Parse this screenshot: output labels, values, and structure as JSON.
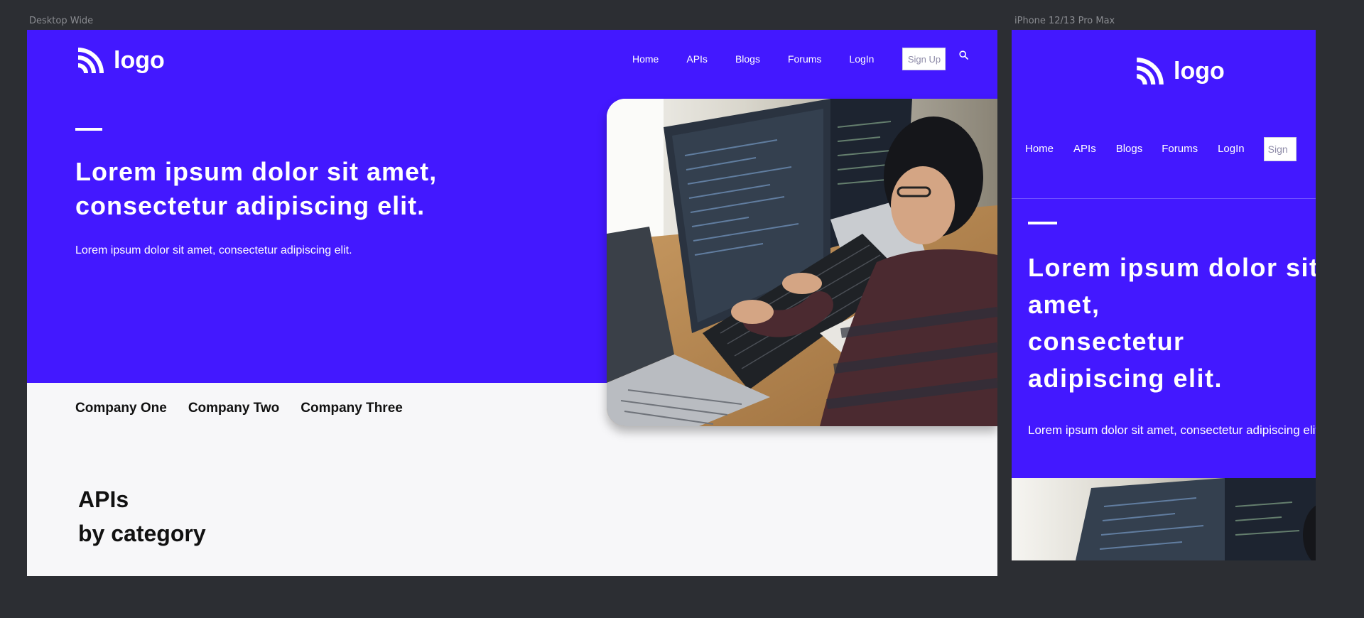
{
  "frames": {
    "desktop_label": "Desktop Wide",
    "mobile_label": "iPhone 12/13 Pro Max"
  },
  "brand": {
    "logo_text": "logo",
    "accent_color": "#4318ff"
  },
  "nav": {
    "items": [
      "Home",
      "APIs",
      "Blogs",
      "Forums",
      "LogIn"
    ],
    "signup_label": "Sign Up",
    "search_icon": "search-icon"
  },
  "hero": {
    "title_line1": "Lorem ipsum dolor sit amet,",
    "title_line2": "consectetur adipiscing elit.",
    "subtitle": "Lorem ipsum dolor sit amet, consectetur adipiscing elit."
  },
  "mobile_hero": {
    "title_line1": "Lorem ipsum dolor sit",
    "title_line2": "amet,",
    "title_line3": "consectetur",
    "title_line4": "adipiscing elit.",
    "subtitle": "Lorem ipsum dolor sit amet, consectetur adipiscing elit."
  },
  "companies": [
    "Company One",
    "Company Two",
    "Company Three"
  ],
  "apis_section": {
    "heading_line1": "APIs",
    "heading_line2": "by category"
  }
}
